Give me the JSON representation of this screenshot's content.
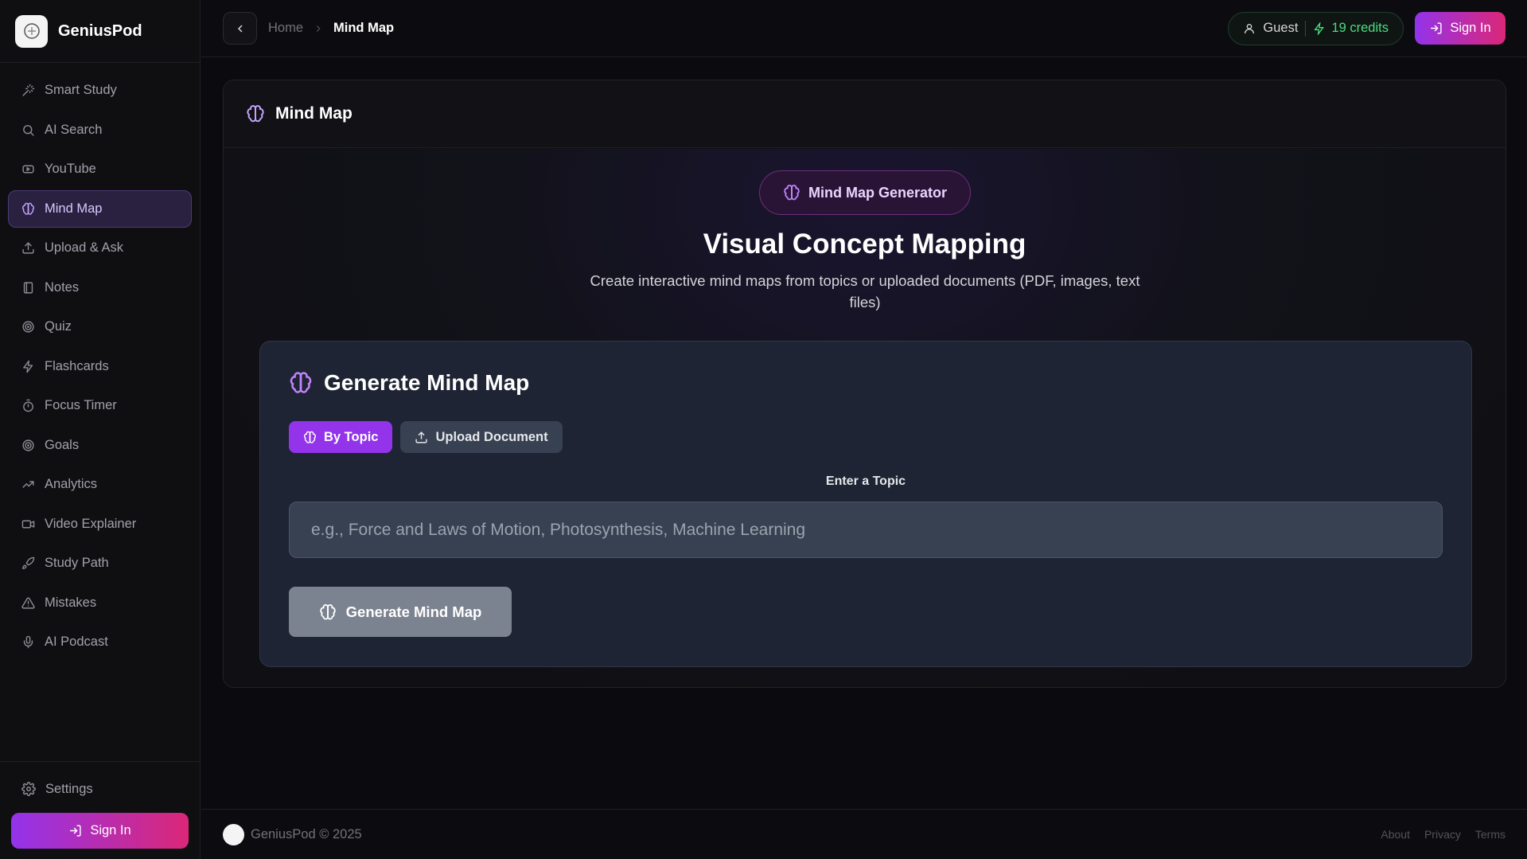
{
  "app": {
    "name": "GeniusPod"
  },
  "sidebar": {
    "items": [
      {
        "label": "Smart Study",
        "icon": "wand-icon"
      },
      {
        "label": "AI Search",
        "icon": "search-icon"
      },
      {
        "label": "YouTube",
        "icon": "youtube-icon"
      },
      {
        "label": "Mind Map",
        "icon": "brain-icon",
        "active": true
      },
      {
        "label": "Upload & Ask",
        "icon": "upload-icon"
      },
      {
        "label": "Notes",
        "icon": "notebook-icon"
      },
      {
        "label": "Quiz",
        "icon": "target-icon"
      },
      {
        "label": "Flashcards",
        "icon": "zap-icon"
      },
      {
        "label": "Focus Timer",
        "icon": "timer-icon"
      },
      {
        "label": "Goals",
        "icon": "target-icon"
      },
      {
        "label": "Analytics",
        "icon": "trending-up-icon"
      },
      {
        "label": "Video Explainer",
        "icon": "video-icon"
      },
      {
        "label": "Study Path",
        "icon": "rocket-icon"
      },
      {
        "label": "Mistakes",
        "icon": "warning-icon"
      },
      {
        "label": "AI Podcast",
        "icon": "microphone-icon"
      }
    ],
    "settings_label": "Settings",
    "signin_label": "Sign In"
  },
  "topbar": {
    "breadcrumb_home": "Home",
    "breadcrumb_current": "Mind Map",
    "guest_label": "Guest",
    "credits_label": "19 credits",
    "signin_label": "Sign In"
  },
  "colors": {
    "accent": "#9333ea",
    "accent_pink": "#db2777",
    "credits": "#4ade80"
  },
  "main": {
    "header_title": "Mind Map",
    "badge_label": "Mind Map Generator",
    "headline": "Visual Concept Mapping",
    "subtext": "Create interactive mind maps from topics or uploaded documents (PDF, images, text files)",
    "form": {
      "title": "Generate Mind Map",
      "tabs": [
        {
          "label": "By Topic",
          "active": true
        },
        {
          "label": "Upload Document",
          "active": false
        }
      ],
      "field_label": "Enter a Topic",
      "placeholder": "e.g., Force and Laws of Motion, Photosynthesis, Machine Learning",
      "value": "",
      "submit_label": "Generate Mind Map"
    }
  },
  "footer": {
    "copyright": "GeniusPod © 2025",
    "links": [
      "About",
      "Privacy",
      "Terms"
    ]
  }
}
